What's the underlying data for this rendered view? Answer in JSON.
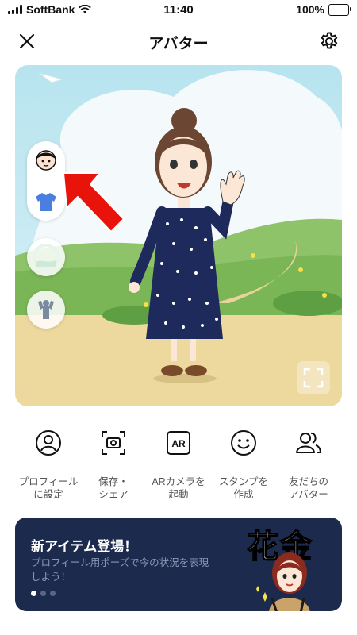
{
  "status": {
    "carrier": "SoftBank",
    "time": "11:40",
    "battery": "100%"
  },
  "header": {
    "title": "アバター",
    "close_icon": "close-icon",
    "settings_icon": "gear-icon"
  },
  "stage": {
    "side_buttons": [
      "face-icon",
      "shirt-icon",
      "background-icon",
      "pose-icon"
    ],
    "fullscreen_icon": "fullscreen-icon"
  },
  "actions": [
    {
      "label": "プロフィール\nに設定",
      "icon": "profile-icon"
    },
    {
      "label": "保存・\nシェア",
      "icon": "camera-save-icon"
    },
    {
      "label": "ARカメラを\n起動",
      "icon": "ar-icon"
    },
    {
      "label": "スタンプを\n作成",
      "icon": "smile-icon"
    },
    {
      "label": "友だちの\nアバター",
      "icon": "friends-icon"
    }
  ],
  "ar_icon_text": "AR",
  "banner": {
    "title": "新アイテム登場！",
    "subtitle": "プロフィール用ポーズで今の状況を表現しよう！",
    "kanji": "花金",
    "active_slide": 1,
    "slide_count": 3
  },
  "colors": {
    "banner_bg": "#1c2a4e",
    "battery_fill": "#4cd964",
    "arrow": "#e8140c"
  }
}
